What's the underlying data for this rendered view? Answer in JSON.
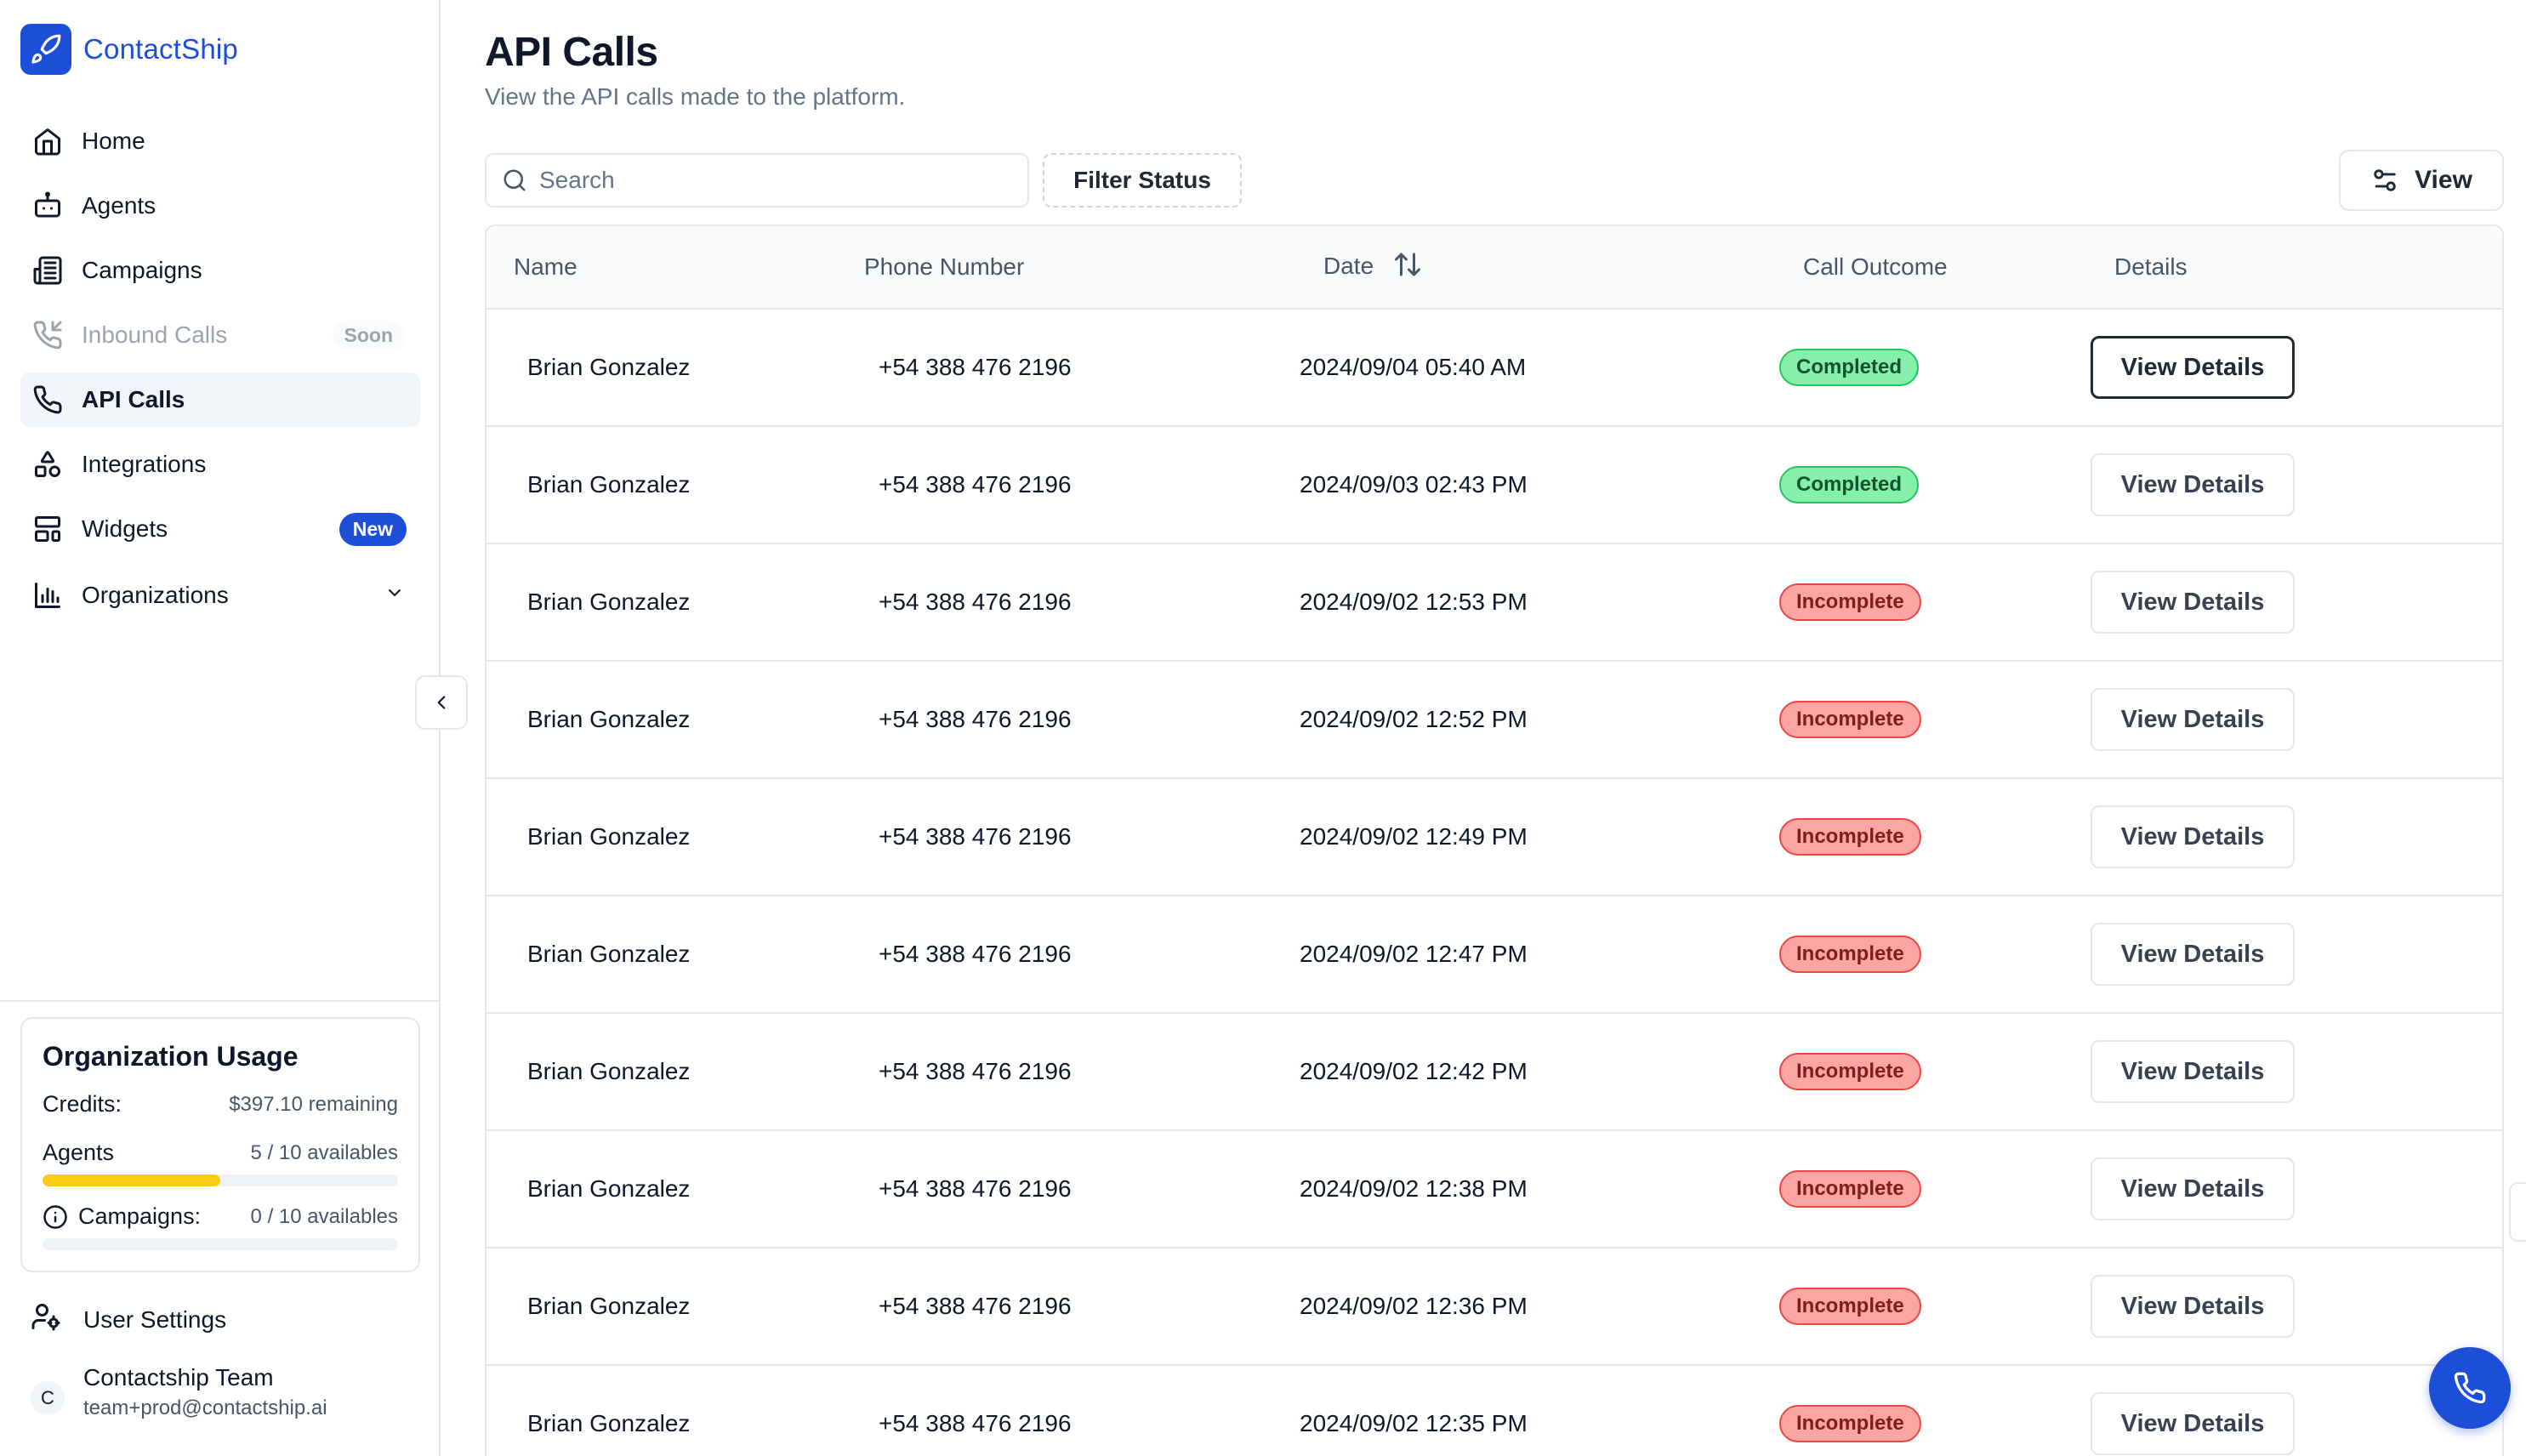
{
  "brand": {
    "name": "ContactShip",
    "accent": "#1d4ed8"
  },
  "sidebar": {
    "items": [
      {
        "label": "Home",
        "icon": "home-icon"
      },
      {
        "label": "Agents",
        "icon": "bot-icon"
      },
      {
        "label": "Campaigns",
        "icon": "newspaper-icon"
      },
      {
        "label": "Inbound Calls",
        "icon": "phone-incoming-icon",
        "badge": "Soon",
        "disabled": true
      },
      {
        "label": "API Calls",
        "icon": "phone-icon",
        "active": true
      },
      {
        "label": "Integrations",
        "icon": "shapes-icon"
      },
      {
        "label": "Widgets",
        "icon": "layout-icon",
        "badge": "New"
      },
      {
        "label": "Organizations",
        "icon": "bar-chart-icon"
      }
    ],
    "usage": {
      "title": "Organization Usage",
      "credits_label": "Credits:",
      "credits_value": "$397.10 remaining",
      "agents_label": "Agents",
      "agents_value": "5 / 10 availables",
      "agents_fraction": 0.5,
      "campaigns_label": "Campaigns:",
      "campaigns_value": "0 / 10 availables",
      "campaigns_fraction": 0.0
    },
    "user_settings": "User Settings",
    "account": {
      "initial": "C",
      "name": "Contactship Team",
      "email": "team+prod@contactship.ai"
    }
  },
  "main": {
    "title": "API Calls",
    "subtitle": "View the API calls made to the platform.",
    "search_placeholder": "Search",
    "filter_label": "Filter Status",
    "view_label": "View",
    "columns": {
      "name": "Name",
      "phone": "Phone Number",
      "date": "Date",
      "outcome": "Call Outcome",
      "details": "Details"
    },
    "rows": [
      {
        "name": "Brian Gonzalez",
        "phone": "+54 388 476 2196",
        "date": "2024/09/04 05:40 AM",
        "outcome": "Completed",
        "details": "View Details"
      },
      {
        "name": "Brian Gonzalez",
        "phone": "+54 388 476 2196",
        "date": "2024/09/03 02:43 PM",
        "outcome": "Completed",
        "details": "View Details"
      },
      {
        "name": "Brian Gonzalez",
        "phone": "+54 388 476 2196",
        "date": "2024/09/02 12:53 PM",
        "outcome": "Incomplete",
        "details": "View Details"
      },
      {
        "name": "Brian Gonzalez",
        "phone": "+54 388 476 2196",
        "date": "2024/09/02 12:52 PM",
        "outcome": "Incomplete",
        "details": "View Details"
      },
      {
        "name": "Brian Gonzalez",
        "phone": "+54 388 476 2196",
        "date": "2024/09/02 12:49 PM",
        "outcome": "Incomplete",
        "details": "View Details"
      },
      {
        "name": "Brian Gonzalez",
        "phone": "+54 388 476 2196",
        "date": "2024/09/02 12:47 PM",
        "outcome": "Incomplete",
        "details": "View Details"
      },
      {
        "name": "Brian Gonzalez",
        "phone": "+54 388 476 2196",
        "date": "2024/09/02 12:42 PM",
        "outcome": "Incomplete",
        "details": "View Details"
      },
      {
        "name": "Brian Gonzalez",
        "phone": "+54 388 476 2196",
        "date": "2024/09/02 12:38 PM",
        "outcome": "Incomplete",
        "details": "View Details"
      },
      {
        "name": "Brian Gonzalez",
        "phone": "+54 388 476 2196",
        "date": "2024/09/02 12:36 PM",
        "outcome": "Incomplete",
        "details": "View Details"
      },
      {
        "name": "Brian Gonzalez",
        "phone": "+54 388 476 2196",
        "date": "2024/09/02 12:35 PM",
        "outcome": "Incomplete",
        "details": "View Details"
      }
    ]
  },
  "colors": {
    "completed": "#86efac",
    "incomplete": "#fca5a5",
    "progress": "#facc15"
  }
}
